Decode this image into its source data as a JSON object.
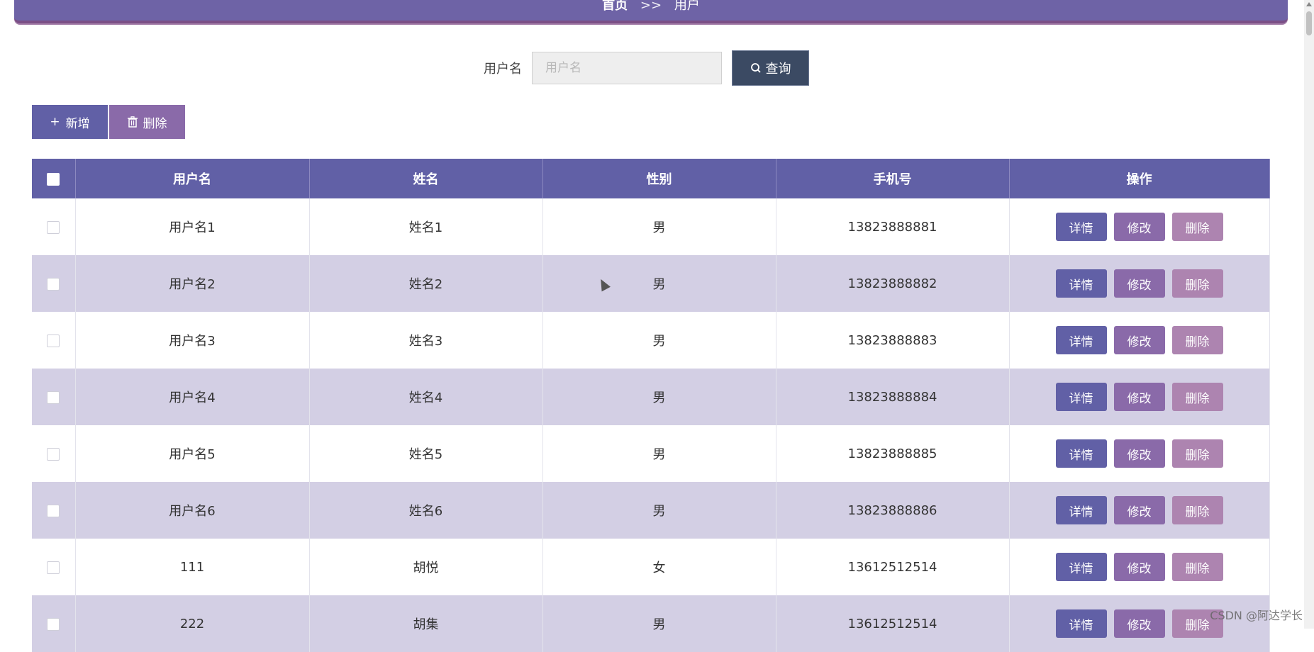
{
  "breadcrumb": {
    "home": "首页",
    "separator": ">>",
    "current": "用户"
  },
  "search": {
    "label": "用户名",
    "placeholder": "用户名",
    "value": "",
    "button": "查询"
  },
  "toolbar": {
    "add": "新增",
    "delete": "删除"
  },
  "table": {
    "headers": [
      "用户名",
      "姓名",
      "性别",
      "手机号",
      "操作"
    ],
    "rows": [
      {
        "username": "用户名1",
        "name": "姓名1",
        "gender": "男",
        "phone": "13823888881"
      },
      {
        "username": "用户名2",
        "name": "姓名2",
        "gender": "男",
        "phone": "13823888882"
      },
      {
        "username": "用户名3",
        "name": "姓名3",
        "gender": "男",
        "phone": "13823888883"
      },
      {
        "username": "用户名4",
        "name": "姓名4",
        "gender": "男",
        "phone": "13823888884"
      },
      {
        "username": "用户名5",
        "name": "姓名5",
        "gender": "男",
        "phone": "13823888885"
      },
      {
        "username": "用户名6",
        "name": "姓名6",
        "gender": "男",
        "phone": "13823888886"
      },
      {
        "username": "111",
        "name": "胡悦",
        "gender": "女",
        "phone": "13612512514"
      },
      {
        "username": "222",
        "name": "胡集",
        "gender": "男",
        "phone": "13612512514"
      }
    ],
    "row_actions": {
      "detail": "详情",
      "edit": "修改",
      "delete": "删除"
    }
  },
  "watermark": "CSDN @阿达学长",
  "colors": {
    "primary": "#6160a6",
    "secondary": "#8a6aa9",
    "danger": "#ad84b0",
    "query": "#3b4a63",
    "stripe": "#d3cfe4"
  }
}
